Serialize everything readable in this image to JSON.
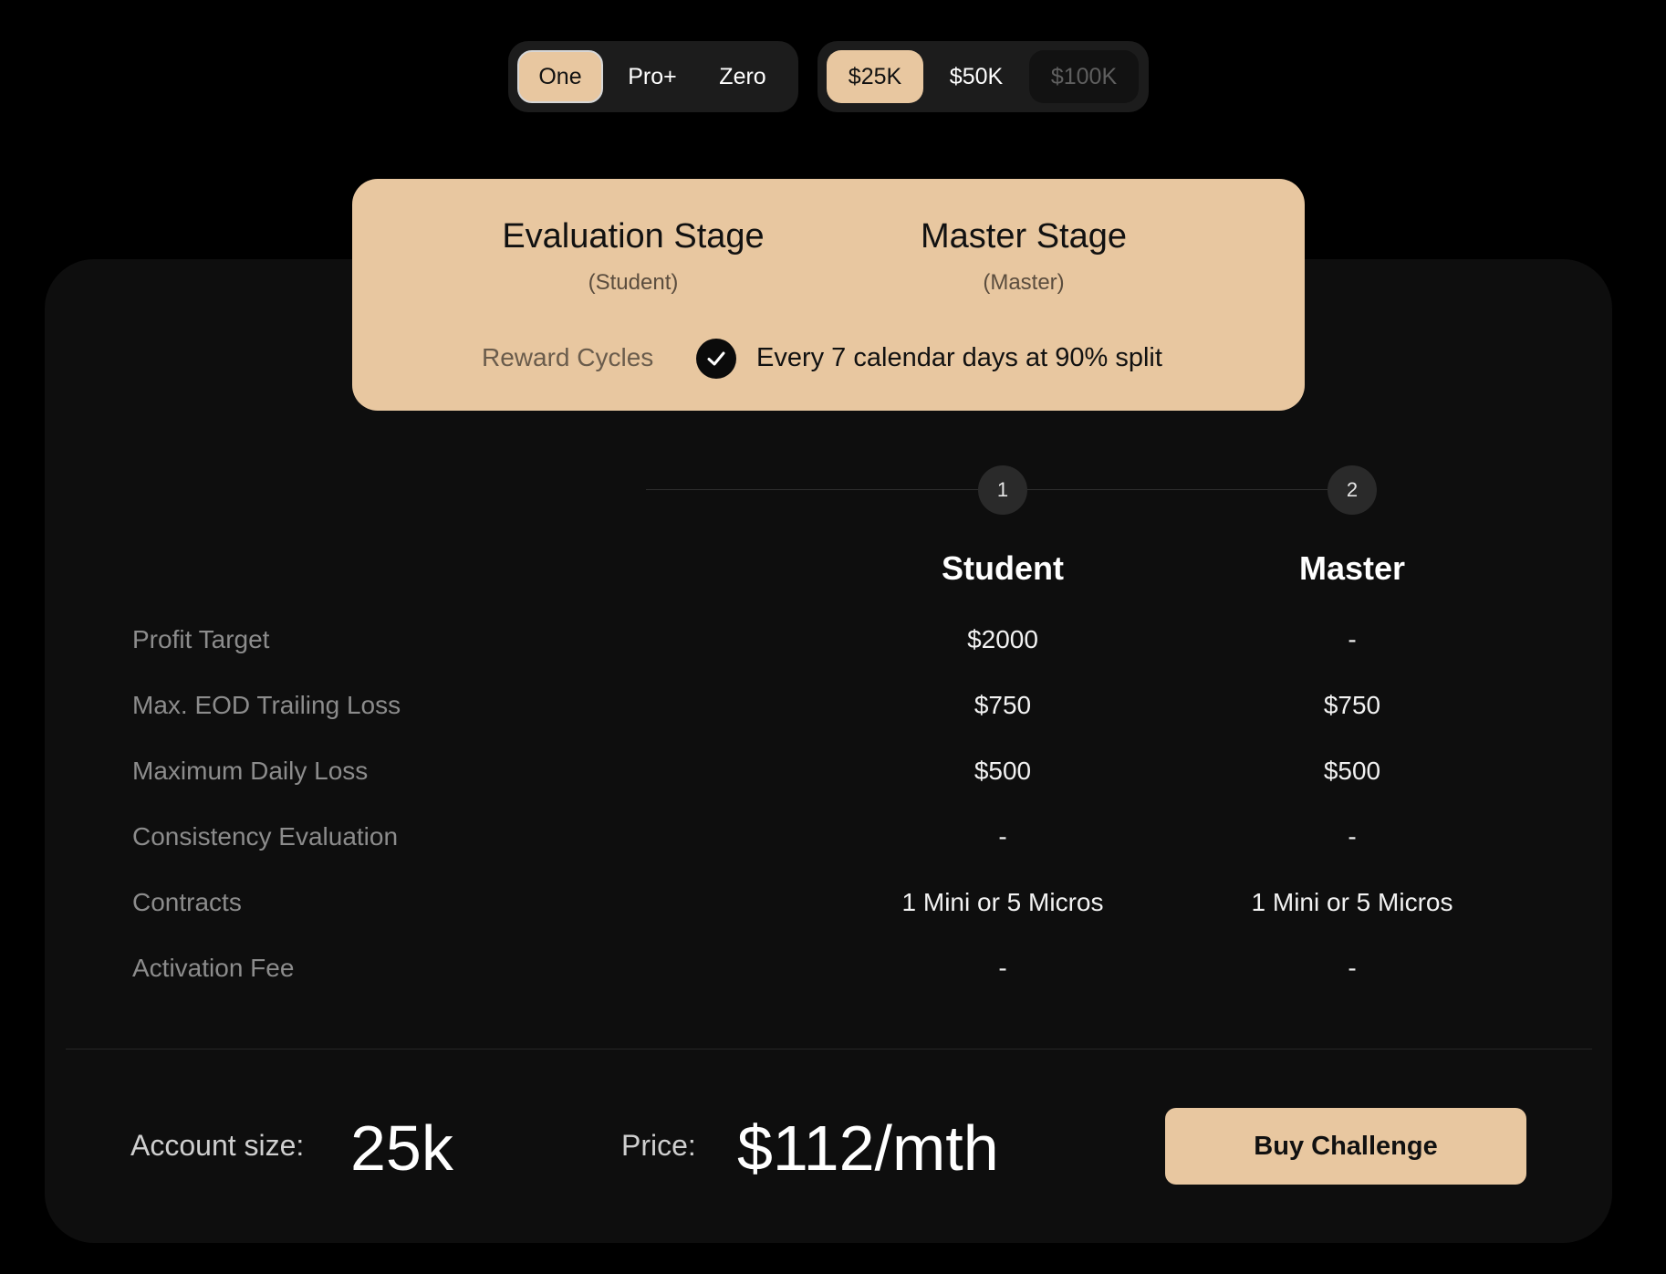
{
  "plan_options": [
    "One",
    "Pro+",
    "Zero"
  ],
  "size_options": [
    "$25K",
    "$50K",
    "$100K"
  ],
  "panel": {
    "evaluation_title": "Evaluation Stage",
    "evaluation_sub": "(Student)",
    "master_title": "Master Stage",
    "master_sub": "(Master)",
    "reward_label": "Reward Cycles",
    "reward_text": "Every 7 calendar days at 90% split"
  },
  "steps": [
    "1",
    "2"
  ],
  "columns": [
    "Student",
    "Master"
  ],
  "rows": [
    {
      "label": "Profit Target",
      "student": "$2000",
      "master": "-"
    },
    {
      "label": "Max. EOD Trailing Loss",
      "student": "$750",
      "master": "$750"
    },
    {
      "label": "Maximum Daily Loss",
      "student": "$500",
      "master": "$500"
    },
    {
      "label": "Consistency Evaluation",
      "student": "-",
      "master": "-"
    },
    {
      "label": "Contracts",
      "student": "1 Mini or 5 Micros",
      "master": "1 Mini or 5 Micros"
    },
    {
      "label": "Activation Fee",
      "student": "-",
      "master": "-"
    }
  ],
  "footer": {
    "account_label": "Account size:",
    "account_value": "25k",
    "price_label": "Price:",
    "price_value": "$112/mth",
    "buy_label": "Buy Challenge"
  },
  "colors": {
    "accent": "#e8c7a0",
    "card": "#0e0e0e",
    "background": "#000000"
  }
}
